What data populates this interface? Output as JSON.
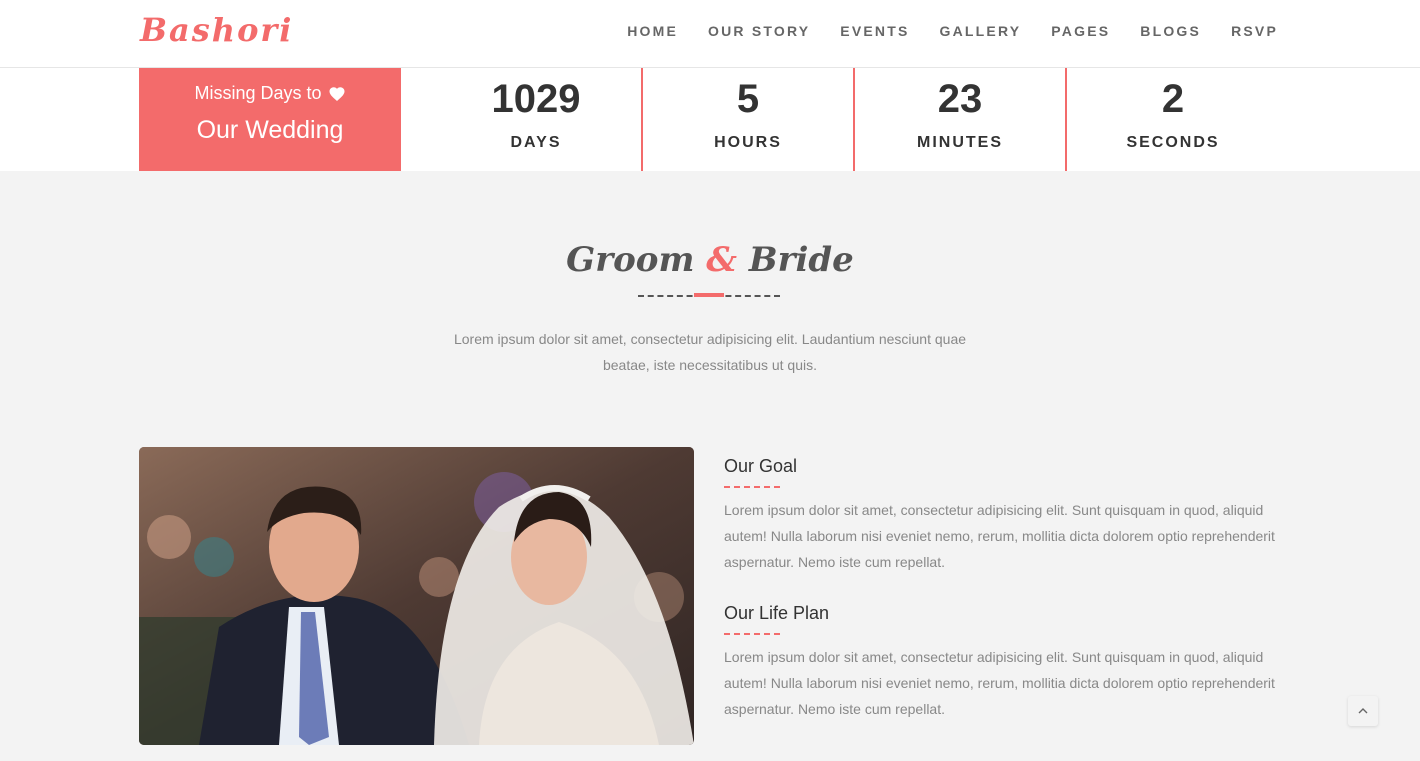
{
  "brand": {
    "logo": "Bashori",
    "accent_color": "#f36b6b"
  },
  "nav": {
    "items": [
      "HOME",
      "OUR STORY",
      "EVENTS",
      "GALLERY",
      "PAGES",
      "BLOGS",
      "RSVP"
    ]
  },
  "countdown": {
    "box_line1": "Missing Days to",
    "box_line2": "Our Wedding",
    "heart_icon": "heart-icon",
    "units": [
      {
        "value": "1029",
        "label": "DAYS"
      },
      {
        "value": "5",
        "label": "HOURS"
      },
      {
        "value": "23",
        "label": "MINUTES"
      },
      {
        "value": "2",
        "label": "SECONDS"
      }
    ]
  },
  "section": {
    "title_part1": "Groom",
    "title_amp": "&",
    "title_part2": "Bride",
    "intro": "Lorem ipsum dolor sit amet, consectetur adipisicing elit. Laudantium nesciunt quae beatae, iste necessitatibus ut quis."
  },
  "blocks": [
    {
      "heading": "Our Goal",
      "text": "Lorem ipsum dolor sit amet, consectetur adipisicing elit. Sunt quisquam in quod, aliquid autem! Nulla laborum nisi eveniet nemo, rerum, mollitia dicta dolorem optio reprehenderit aspernatur. Nemo iste cum repellat."
    },
    {
      "heading": "Our Life Plan",
      "text": "Lorem ipsum dolor sit amet, consectetur adipisicing elit. Sunt quisquam in quod, aliquid autem! Nulla laborum nisi eveniet nemo, rerum, mollitia dicta dolorem optio reprehenderit aspernatur. Nemo iste cum repellat."
    }
  ],
  "scroll_top_icon": "chevron-up-icon"
}
